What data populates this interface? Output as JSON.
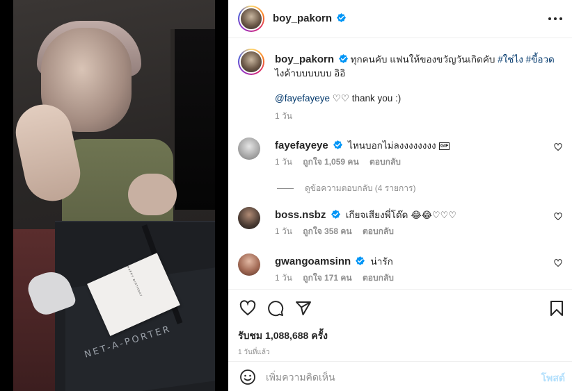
{
  "post": {
    "author": "boy_pakorn",
    "verified_color": "#0095f6",
    "caption": "ทุกคนคับ แฟนให้ของขวัญวันเกิดคับ ",
    "caption_tags": [
      "#ใช่ไง",
      "#ขี้อวด"
    ],
    "caption_tail": "ไงค้าบบบบบบ อิอิ",
    "mention": "@fayefayeye",
    "mention_suffix": "♡♡ thank you :)",
    "caption_time": "1 วัน",
    "media_brand_text": "NET-A-PORTER",
    "media_card_text": "HAPPY BIRTHDAY"
  },
  "comments": [
    {
      "user": "fayefayeye",
      "verified": true,
      "text": "ไหนบอกไม่ลงงงงงงงง",
      "sticker": "GIF",
      "time": "1 วัน",
      "likes": "ถูกใจ 1,059 คน",
      "reply": "ตอบกลับ"
    },
    {
      "user": "boss.nsbz",
      "verified": true,
      "text": "เกียจเสียงพี่โด๊ด",
      "emoji": "😂😂♡♡♡",
      "time": "1 วัน",
      "likes": "ถูกใจ 358 คน",
      "reply": "ตอบกลับ"
    },
    {
      "user": "gwangoamsinn",
      "verified": true,
      "text": "น่ารัก",
      "time": "1 วัน",
      "likes": "ถูกใจ 171 คน",
      "reply": "ตอบกลับ"
    }
  ],
  "view_replies": "ดูข้อความตอบกลับ (4 รายการ)",
  "actions": {
    "views": "รับชม 1,088,688 ครั้ง",
    "posted": "1 วันที่แล้ว"
  },
  "comment_box": {
    "placeholder": "เพิ่มความคิดเห็น",
    "post_label": "โพสต์"
  },
  "colors": {
    "link": "#00376b",
    "muted": "#8e8e8e",
    "post_button_disabled": "#b2dffc"
  },
  "icons": [
    "more-icon",
    "verified-icon",
    "heart-icon",
    "comment-icon",
    "share-icon",
    "bookmark-icon",
    "emoji-icon"
  ]
}
